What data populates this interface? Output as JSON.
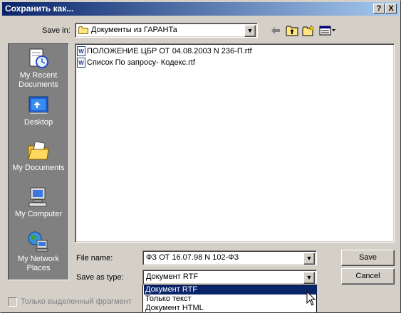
{
  "window": {
    "title": "Сохранить как...",
    "help_glyph": "?",
    "close_glyph": "X"
  },
  "toolbar": {
    "save_in_label": "Save in:",
    "save_in_value": "Документы из ГАРАНТа",
    "icons": [
      "back-arrow-icon",
      "up-folder-icon",
      "new-folder-icon",
      "view-menu-icon"
    ]
  },
  "places": [
    {
      "label_1": "My Recent",
      "label_2": "Documents",
      "icon": "recent-documents-icon"
    },
    {
      "label_1": "Desktop",
      "label_2": "",
      "icon": "desktop-icon"
    },
    {
      "label_1": "My Documents",
      "label_2": "",
      "icon": "my-documents-icon"
    },
    {
      "label_1": "My Computer",
      "label_2": "",
      "icon": "my-computer-icon"
    },
    {
      "label_1": "My Network",
      "label_2": "Places",
      "icon": "network-places-icon"
    }
  ],
  "files": [
    {
      "name": "ПОЛОЖЕНИЕ ЦБР ОТ 04.08.2003 N 236-П.rtf",
      "icon_letter": "W"
    },
    {
      "name": "Список По запросу- Кодекс.rtf",
      "icon_letter": "W"
    }
  ],
  "form": {
    "file_name_label": "File name:",
    "file_name_value": "ФЗ ОТ 16.07.98 N 102-ФЗ",
    "save_as_type_label": "Save as type:",
    "save_as_type_value": "Документ RTF",
    "save_button": "Save",
    "cancel_button": "Cancel",
    "checkbox_label": "Только выделенный фрагмент"
  },
  "type_options": [
    {
      "label": "Документ RTF",
      "selected": true
    },
    {
      "label": "Только текст",
      "selected": false
    },
    {
      "label": "Документ HTML",
      "selected": false
    }
  ],
  "colors": {
    "title_start": "#0a246a",
    "title_end": "#a6caf0",
    "face": "#d4d0c8",
    "places_bg": "#808080",
    "selection": "#0a246a"
  }
}
